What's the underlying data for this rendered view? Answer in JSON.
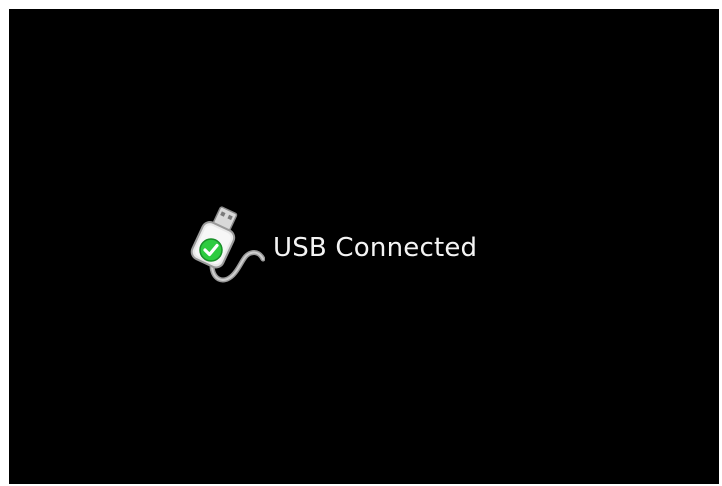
{
  "status": {
    "label": "USB Connected",
    "icon": "usb-connected-icon",
    "check_color": "#2ecc40"
  }
}
